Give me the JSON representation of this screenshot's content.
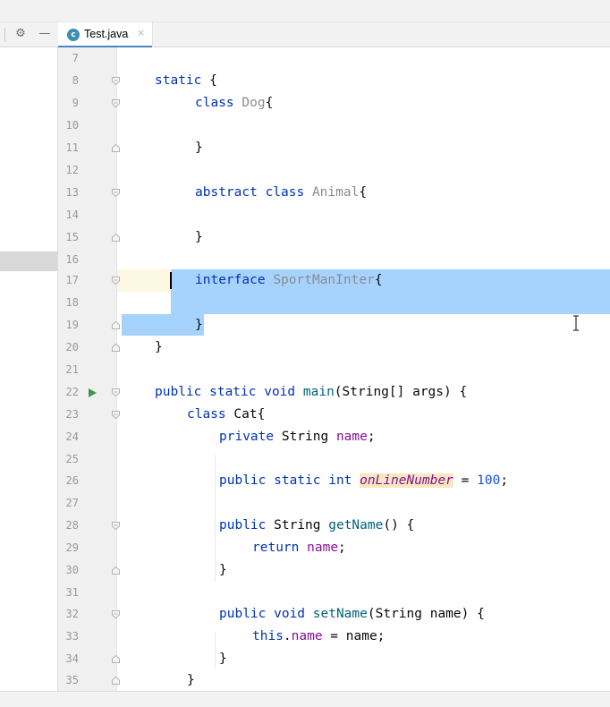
{
  "tab": {
    "filename": "Test.java",
    "icon": "java-class-icon",
    "close_glyph": "×"
  },
  "toolbar": {
    "settings_icon": "gear-icon",
    "hide_icon": "minus-icon"
  },
  "editor": {
    "selection_text": "interface SportManInter{ }",
    "caret_line": 17,
    "highlighted_identifier": "onLineNumber",
    "lines": [
      {
        "n": "7",
        "text": ""
      },
      {
        "n": "8",
        "text": "static {"
      },
      {
        "n": "9",
        "text": "class Dog{"
      },
      {
        "n": "10",
        "text": ""
      },
      {
        "n": "11",
        "text": "}"
      },
      {
        "n": "12",
        "text": ""
      },
      {
        "n": "13",
        "text": "abstract class Animal{"
      },
      {
        "n": "14",
        "text": ""
      },
      {
        "n": "15",
        "text": "}"
      },
      {
        "n": "16",
        "text": ""
      },
      {
        "n": "17",
        "text": "interface SportManInter{"
      },
      {
        "n": "18",
        "text": ""
      },
      {
        "n": "19",
        "text": "}"
      },
      {
        "n": "20",
        "text": "}"
      },
      {
        "n": "21",
        "text": ""
      },
      {
        "n": "22",
        "text": "public static void main(String[] args) {"
      },
      {
        "n": "23",
        "text": "class Cat{"
      },
      {
        "n": "24",
        "text": "private String name;"
      },
      {
        "n": "25",
        "text": ""
      },
      {
        "n": "26",
        "text": "public static int onLineNumber = 100;"
      },
      {
        "n": "27",
        "text": ""
      },
      {
        "n": "28",
        "text": "public String getName() {"
      },
      {
        "n": "29",
        "text": "return name;"
      },
      {
        "n": "30",
        "text": "}"
      },
      {
        "n": "31",
        "text": ""
      },
      {
        "n": "32",
        "text": "public void setName(String name) {"
      },
      {
        "n": "33",
        "text": "this.name = name;"
      },
      {
        "n": "34",
        "text": "}"
      },
      {
        "n": "35",
        "text": "}"
      }
    ]
  },
  "colors": {
    "keyword": "#0033b3",
    "class_name_dim": "#8c8c8c",
    "field": "#871094",
    "number": "#1750eb",
    "method": "#00627a",
    "selection": "#a6d2fe",
    "run_icon": "#3c9b47"
  }
}
